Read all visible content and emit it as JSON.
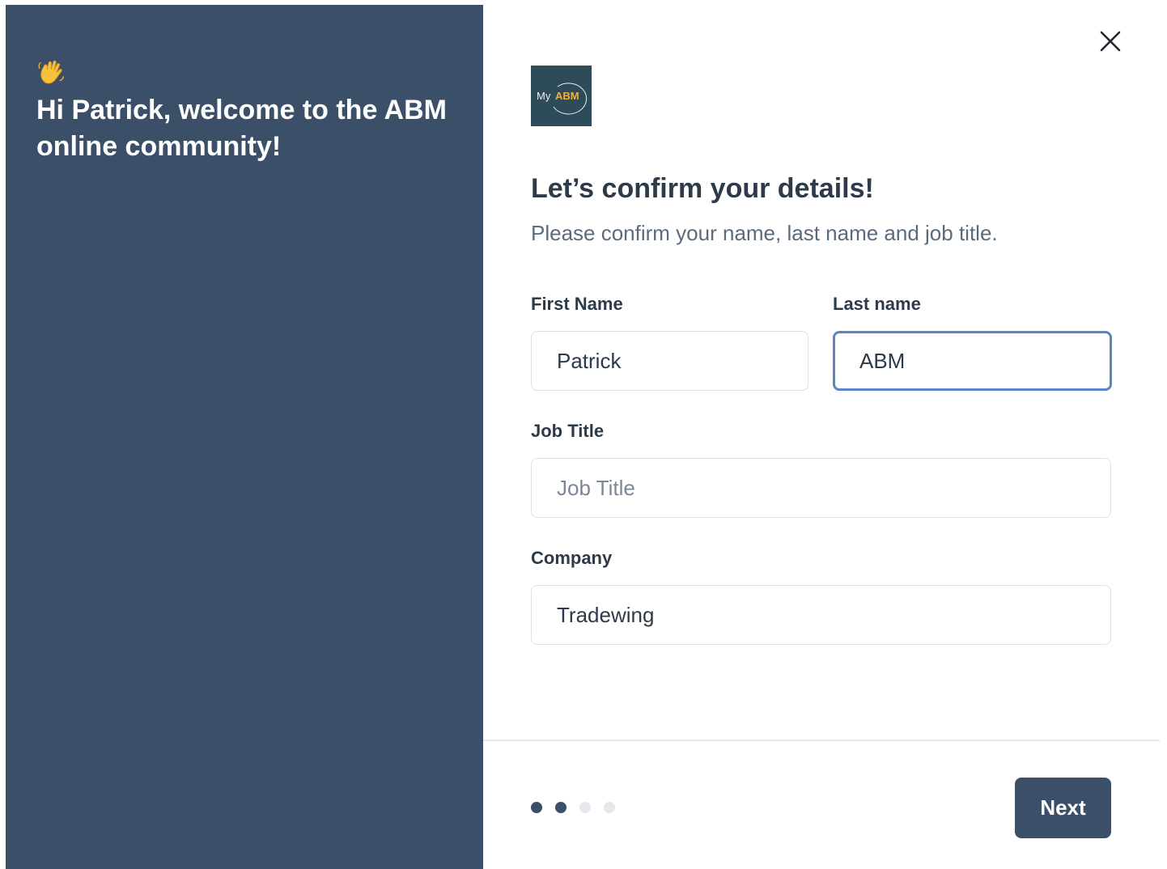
{
  "welcome_panel": {
    "icon": "waving-hand-icon",
    "message": "Hi Patrick, welcome to the ABM online community!"
  },
  "logo": {
    "prefix": "My",
    "brand": "ABM",
    "brand_color": "#f2b13b"
  },
  "close": {
    "icon": "close-icon"
  },
  "form": {
    "heading": "Let’s confirm your details!",
    "subheading": "Please confirm your name, last name and job title.",
    "first_name": {
      "label": "First Name",
      "value": "Patrick"
    },
    "last_name": {
      "label": "Last name",
      "value": "ABM",
      "focused": true
    },
    "job_title": {
      "label": "Job Title",
      "value": "",
      "placeholder": "Job Title"
    },
    "company": {
      "label": "Company",
      "value": "Tradewing"
    }
  },
  "footer": {
    "steps_total": 4,
    "current_step": 2,
    "next_label": "Next"
  },
  "colors": {
    "panel": "#3b5068",
    "button": "#3b5068",
    "focus_border": "#5a86c5",
    "heading_text": "#2d3a4a"
  }
}
